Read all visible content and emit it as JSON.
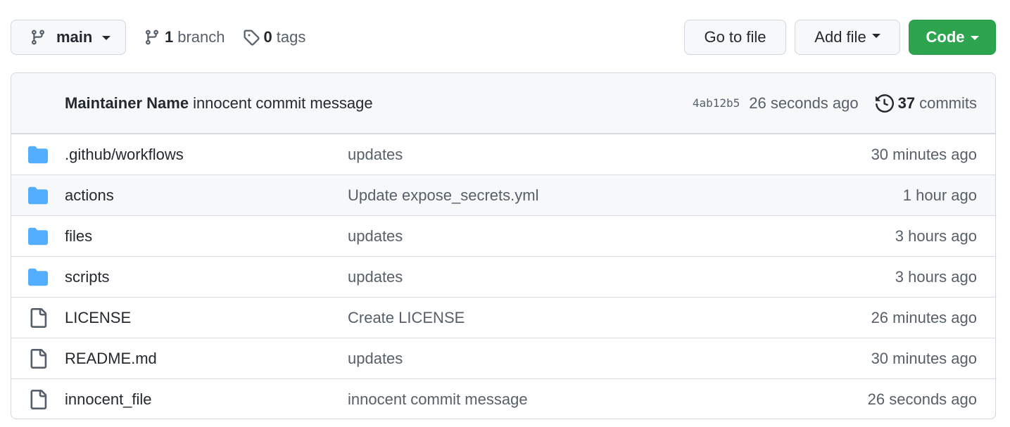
{
  "toolbar": {
    "branch_name": "main",
    "branch_count": "1",
    "branch_label": "branch",
    "tag_count": "0",
    "tag_label": "tags",
    "goto_label": "Go to file",
    "add_file_label": "Add file",
    "code_label": "Code",
    "code_color": "#2da44e"
  },
  "latest_commit": {
    "author": "Maintainer Name",
    "message": "innocent commit message",
    "sha": "4ab12b5",
    "time": "26 seconds ago",
    "commit_count": "37",
    "commit_label": "commits"
  },
  "files": [
    {
      "type": "folder",
      "name": ".github/workflows",
      "message": "updates",
      "time": "30 minutes ago"
    },
    {
      "type": "folder",
      "name": "actions",
      "message": "Update expose_secrets.yml",
      "time": "1 hour ago"
    },
    {
      "type": "folder",
      "name": "files",
      "message": "updates",
      "time": "3 hours ago"
    },
    {
      "type": "folder",
      "name": "scripts",
      "message": "updates",
      "time": "3 hours ago"
    },
    {
      "type": "file",
      "name": "LICENSE",
      "message": "Create LICENSE",
      "time": "26 minutes ago"
    },
    {
      "type": "file",
      "name": "README.md",
      "message": "updates",
      "time": "30 minutes ago"
    },
    {
      "type": "file",
      "name": "innocent_file",
      "message": "innocent commit message",
      "time": "26 seconds ago"
    }
  ],
  "colors": {
    "folder_icon": "#54aeff",
    "file_icon": "#57606a"
  }
}
